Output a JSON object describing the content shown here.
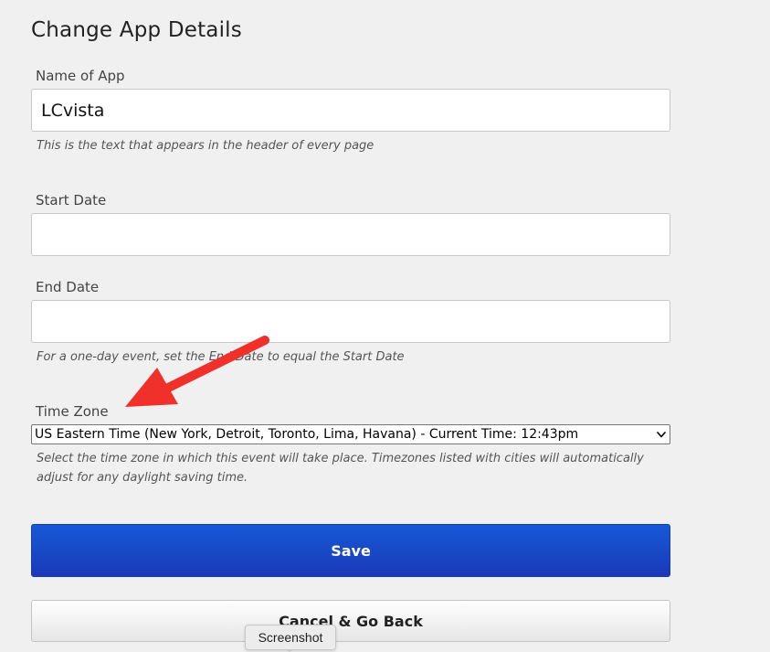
{
  "page": {
    "title": "Change App Details"
  },
  "form": {
    "app_name": {
      "label": "Name of App",
      "value": "LCvista",
      "help": "This is the text that appears in the header of every page"
    },
    "start_date": {
      "label": "Start Date",
      "value": ""
    },
    "end_date": {
      "label": "End Date",
      "value": "",
      "help": "For a one-day event, set the End Date to equal the Start Date"
    },
    "time_zone": {
      "label": "Time Zone",
      "selected": "US Eastern Time (New York, Detroit, Toronto, Lima, Havana) - Current Time: 12:43pm",
      "help": "Select the time zone in which this event will take place. Timezones listed with cities will automatically adjust for any daylight saving time."
    }
  },
  "buttons": {
    "save_label": "Save",
    "cancel_label": "Cancel & Go Back"
  },
  "tooltip": {
    "label": "Screenshot"
  },
  "colors": {
    "background": "#f0f0f0",
    "save_button": "#1a4ac8",
    "annotation_arrow": "#f0302a"
  },
  "icons": {
    "select_chevron": "chevron-down-icon",
    "annotation": "red-arrow-icon"
  }
}
